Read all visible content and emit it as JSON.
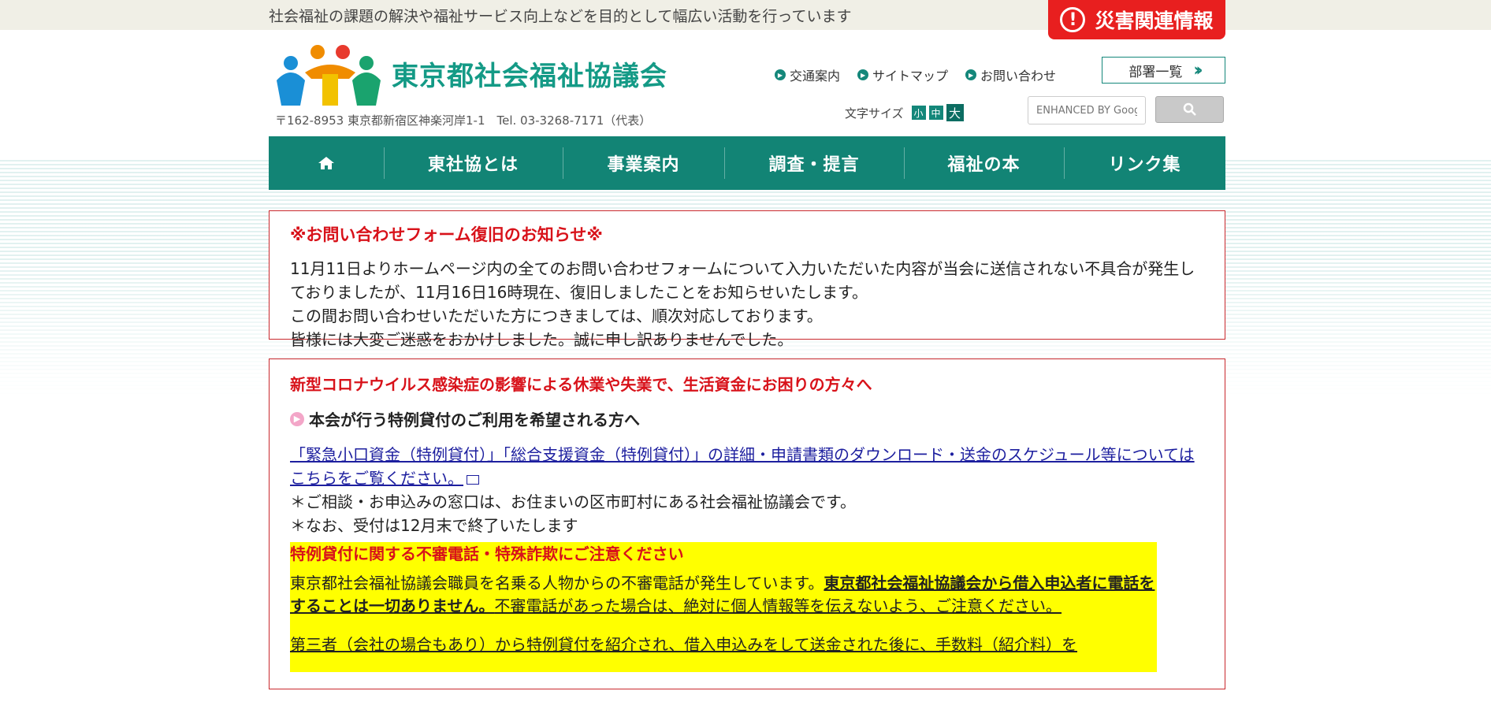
{
  "topbar": {
    "tagline": "社会福祉の課題の解決や福祉サービス向上などを目的として幅広い活動を行っています",
    "disaster_label": "災害関連情報",
    "disaster_icon": "!"
  },
  "header": {
    "logo_text_part1": "東京都社",
    "logo_text_part2": "会福祉協議会",
    "address": "〒162-8953 東京都新宿区神楽河岸1-1　Tel. 03-3268-7171（代表）",
    "links": [
      "交通案内",
      "サイトマップ",
      "お問い合わせ"
    ],
    "dept_label": "部署一覧",
    "fontsize_label": "文字サイズ",
    "fontsize_options": [
      "小",
      "中",
      "大"
    ],
    "search_placeholder": "ENHANCED BY Google"
  },
  "nav": {
    "items": [
      "東社協とは",
      "事業案内",
      "調査・提言",
      "福祉の本",
      "リンク集"
    ]
  },
  "notice": {
    "title": "※お問い合わせフォーム復旧のお知らせ※",
    "line1": "11月11日よりホームページ内の全てのお問い合わせフォームについて入力いただいた内容が当会に送信されない不具合が発生しておりましたが、11月16日16時現在、復旧しましたことをお知らせいたします。",
    "line2": "この間お問い合わせいただいた方につきましては、順次対応しております。",
    "line3": "皆様には大変ご迷惑をおかけしました。誠に申し訳ありませんでした。"
  },
  "covid": {
    "title": "新型コロナウイルス感染症の影響による休業や失業で、生活資金にお困りの方々へ",
    "subhead": "本会が行う特例貸付のご利用を希望される方へ",
    "link": "「緊急小口資金（特例貸付）」「総合支援資金（特例貸付）」の詳細・申請書類のダウンロード・送金のスケジュール等についてはこちらをご覧ください。",
    "note1": "＊ご相談・お申込みの窓口は、お住まいの区市町村にある社会福祉協議会です。",
    "note2": "＊なお、受付は12月末で終了いたします",
    "warn_title": "特例貸付に関する不審電話・特殊詐欺にご注意ください",
    "warn_text1": "東京都社会福祉協議会職員を名乗る人物からの不審電話が発生しています。",
    "warn_bold": "東京都社会福祉協議会から借入申込者に電話をすることは一切ありません。",
    "warn_text2": "不審電話があった場合は、絶対に個人情報等を伝えないよう、ご注意ください。",
    "warn_text3": "第三者（会社の場合もあり）から特例貸付を紹介され、借入申込みをして送金された後に、手数料（紹介料）を"
  },
  "colors": {
    "brand_green": "#128475",
    "alert_red": "#e81f1f",
    "title_red": "#d8121a",
    "highlight_yellow": "#ffff00"
  }
}
